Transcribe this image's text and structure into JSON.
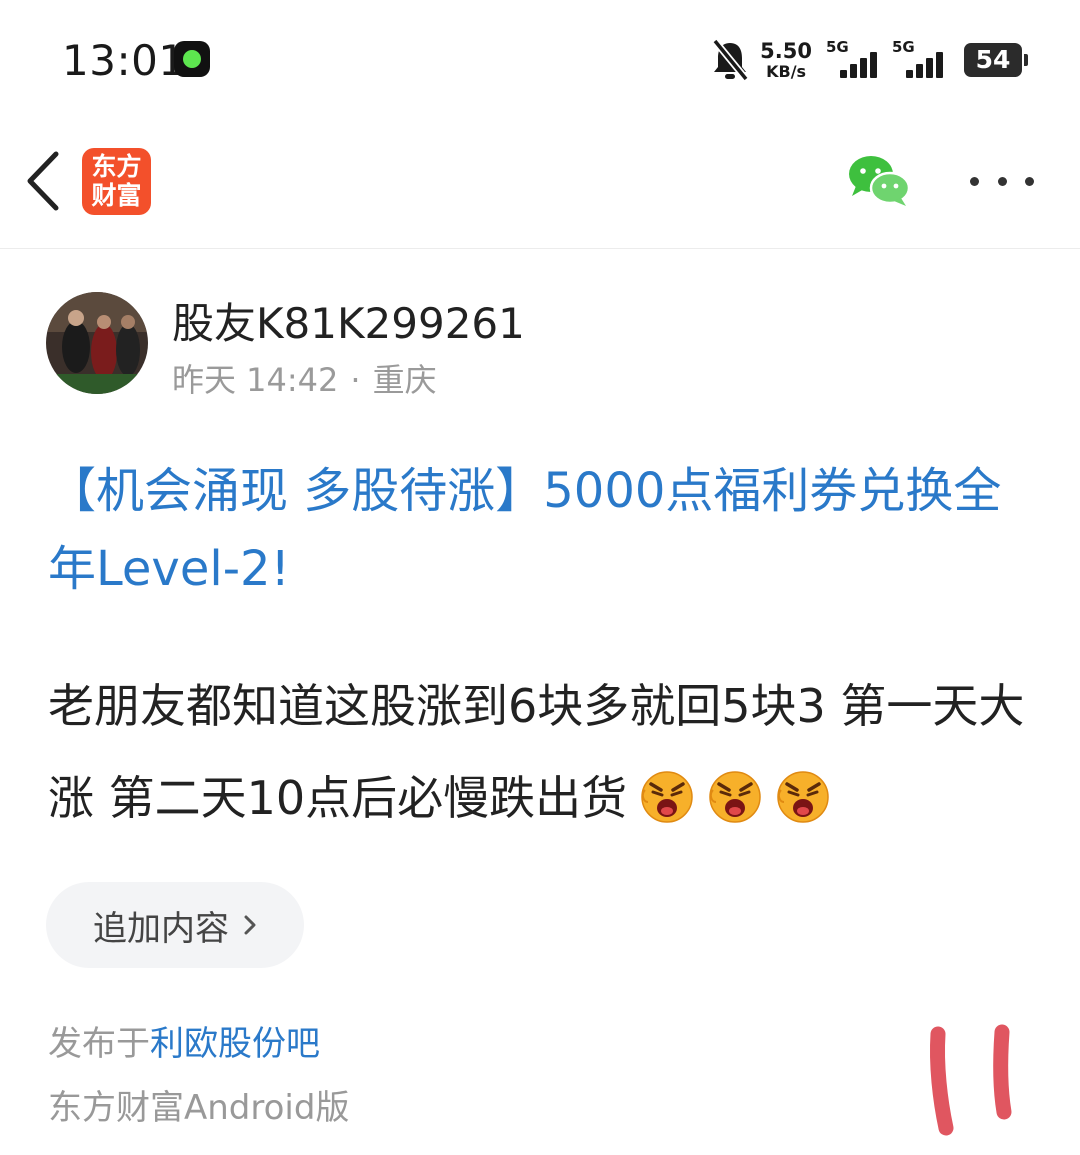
{
  "status_bar": {
    "time": "13:01",
    "speed_value": "5.50",
    "speed_unit": "KB/s",
    "sim1_label": "5G",
    "sim2_label": "5G",
    "battery": "54",
    "icons": [
      "app-notification-icon",
      "silent-bell-icon",
      "signal-icon",
      "battery-icon"
    ]
  },
  "nav": {
    "logo_line1": "东方",
    "logo_line2": "财富",
    "icons": [
      "back-icon",
      "wechat-icon",
      "more-icon"
    ],
    "accent": "#f3502b"
  },
  "author": {
    "name": "股友K81K299261",
    "date": "昨天 14:42",
    "separator": "·",
    "location": "重庆"
  },
  "post": {
    "title": "【机会涌现 多股待涨】5000点福利券兑换全年Level-2!",
    "body": "老朋友都知道这股涨到6块多就回5块3 第一天大涨 第二天10点后必慢跌出货",
    "emoji_count": 3,
    "emoji_name": "angry-face-emoji",
    "title_color": "#2a79c9"
  },
  "actions": {
    "add_content": "追加内容"
  },
  "footer": {
    "published_prefix": "发布于",
    "bar_name": "利欧股份吧",
    "platform": "东方财富Android版"
  }
}
